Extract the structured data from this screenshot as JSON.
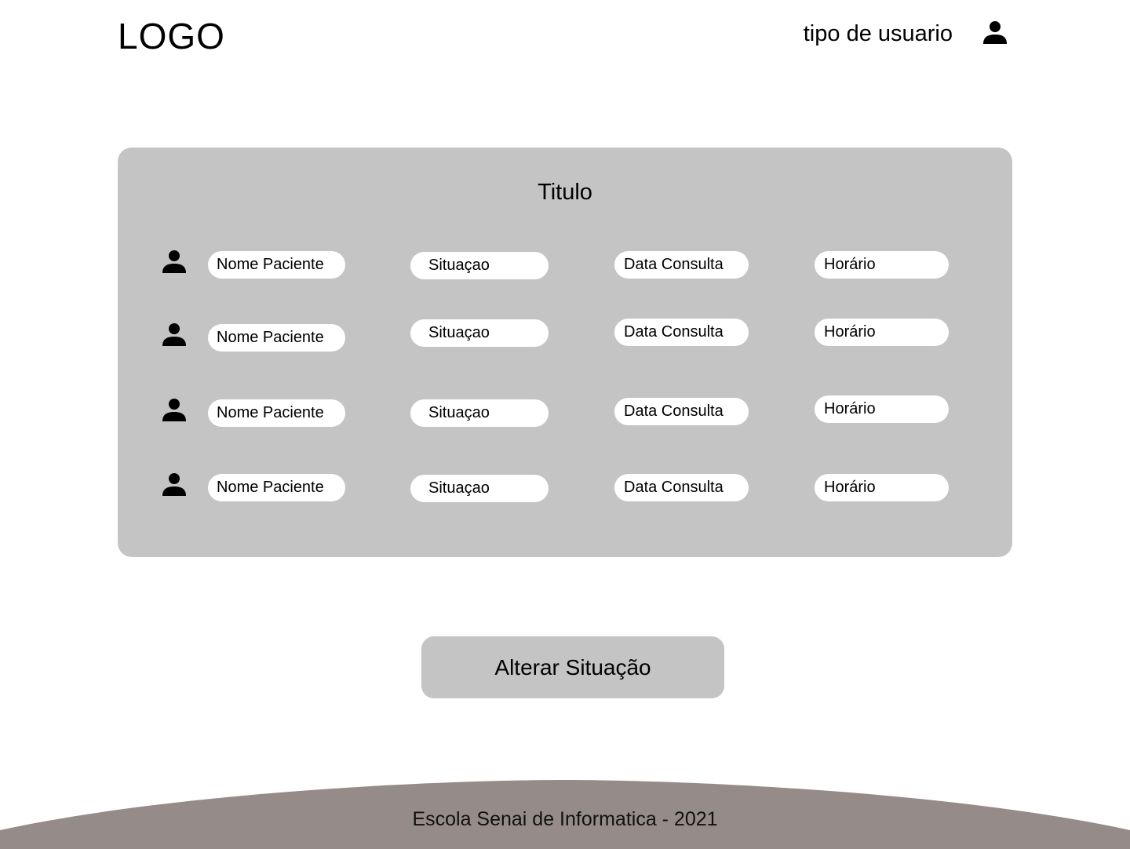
{
  "header": {
    "logo": "LOGO",
    "user_type": "tipo de usuario",
    "user_icon": "user-icon"
  },
  "card": {
    "title": "Titulo",
    "rows": [
      {
        "icon": "user-icon",
        "name": "Nome Paciente",
        "status": "Situaçao",
        "date": "Data Consulta",
        "time": "Horário"
      },
      {
        "icon": "user-icon",
        "name": "Nome Paciente",
        "status": "Situaçao",
        "date": "Data Consulta",
        "time": "Horário"
      },
      {
        "icon": "user-icon",
        "name": "Nome Paciente",
        "status": "Situaçao",
        "date": "Data Consulta",
        "time": "Horário"
      },
      {
        "icon": "user-icon",
        "name": "Nome Paciente",
        "status": "Situaçao",
        "date": "Data Consulta",
        "time": "Horário"
      }
    ]
  },
  "actions": {
    "change_status_label": "Alterar Situação"
  },
  "footer": {
    "text": "Escola Senai de Informatica - 2021"
  },
  "colors": {
    "card_background": "#c4c4c4",
    "pill_background": "#ffffff",
    "button_background": "#c4c4c4",
    "footer_background": "#958b89"
  }
}
